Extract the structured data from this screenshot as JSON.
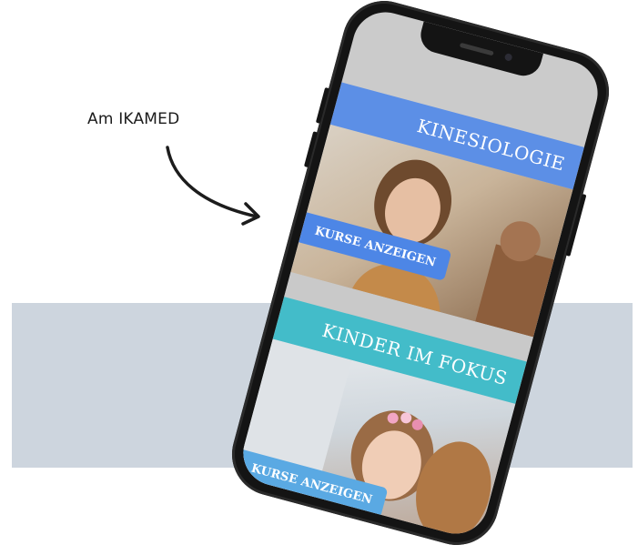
{
  "caption": "Am IKAMED",
  "phone": {
    "sections": [
      {
        "title": "KINESIOLOGIE",
        "button_label": "KURSE ANZEIGEN",
        "color": "#5c8fe6"
      },
      {
        "title": "KINDER IM FOKUS",
        "button_label": "KURSE ANZEIGEN",
        "color": "#43bcc9"
      }
    ]
  },
  "colors": {
    "band": "#cdd5de",
    "phone_frame": "#141414"
  }
}
